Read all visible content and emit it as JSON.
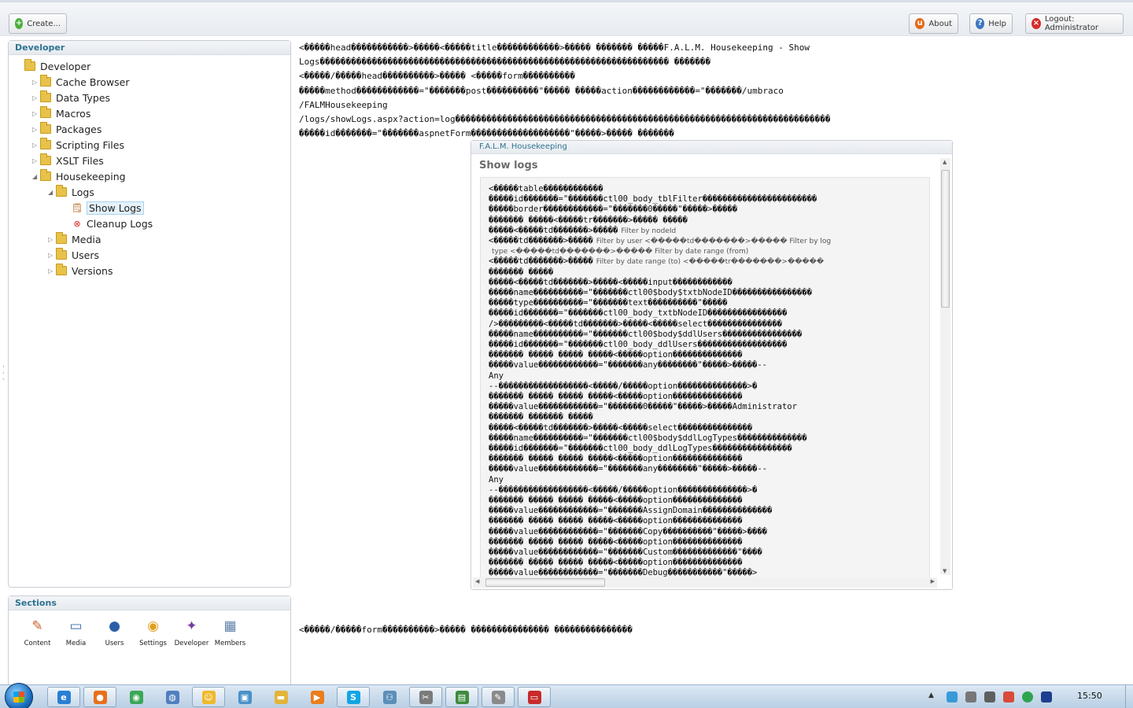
{
  "toolbar": {
    "create_label": "Create...",
    "about_label": "About",
    "help_label": "Help",
    "logout_label": "Logout: Administrator"
  },
  "developer_panel": {
    "header": "Developer",
    "tree": [
      {
        "label": "Developer",
        "level": 0,
        "icon": "folder-icon",
        "arrow": ""
      },
      {
        "label": "Cache Browser",
        "level": 1,
        "icon": "folder-icon",
        "arrow": "collapsed"
      },
      {
        "label": "Data Types",
        "level": 1,
        "icon": "folder-icon",
        "arrow": "collapsed"
      },
      {
        "label": "Macros",
        "level": 1,
        "icon": "folder-icon",
        "arrow": "collapsed"
      },
      {
        "label": "Packages",
        "level": 1,
        "icon": "folder-icon",
        "arrow": "collapsed"
      },
      {
        "label": "Scripting Files",
        "level": 1,
        "icon": "folder-icon",
        "arrow": "collapsed"
      },
      {
        "label": "XSLT Files",
        "level": 1,
        "icon": "folder-icon",
        "arrow": "collapsed"
      },
      {
        "label": "Housekeeping",
        "level": 1,
        "icon": "folder-icon",
        "arrow": "expanded"
      },
      {
        "label": "Logs",
        "level": 2,
        "icon": "folder-icon",
        "arrow": "expanded"
      },
      {
        "label": "Show Logs",
        "level": 3,
        "icon": "show-logs-icon",
        "arrow": "",
        "selected": true
      },
      {
        "label": "Cleanup Logs",
        "level": 3,
        "icon": "cleanup-logs-icon",
        "arrow": ""
      },
      {
        "label": "Media",
        "level": 2,
        "icon": "folder-icon",
        "arrow": "collapsed"
      },
      {
        "label": "Users",
        "level": 2,
        "icon": "folder-icon",
        "arrow": "collapsed"
      },
      {
        "label": "Versions",
        "level": 2,
        "icon": "folder-icon",
        "arrow": "collapsed"
      }
    ]
  },
  "sections_panel": {
    "header": "Sections",
    "items": [
      {
        "label": "Content",
        "icon": "content-icon"
      },
      {
        "label": "Media",
        "icon": "media-icon"
      },
      {
        "label": "Users",
        "icon": "users-icon"
      },
      {
        "label": "Settings",
        "icon": "settings-icon"
      },
      {
        "label": "Developer",
        "icon": "developer-icon"
      },
      {
        "label": "Members",
        "icon": "members-icon"
      }
    ]
  },
  "garbled_text": [
    "<�����head�����������>�����<�����title������������>����� ������� �����F.A.L.M. Housekeeping - Show",
    "Logs������������������������������������������������������������������� �������",
    "<�����/�����head����������>����� <�����form����������",
    "�����method������������=\"�������post����������\"����� �����action������������=\"�������/umbraco",
    "/FALMHousekeeping",
    "/logs/showLogs.aspx?action=log������������������������������������������������������������������������",
    "�����id�������=\"�������aspnetForm�������������������\"�����>����� �������"
  ],
  "garbled_footer": "<�����/�����form����������>����� ��������������� ���������������",
  "inner_window": {
    "header": "F.A.L.M. Housekeeping",
    "title": "Show logs",
    "code_lines": [
      {
        "text": "<�����table������������",
        "hint": ""
      },
      {
        "text": "�����id�������=\"�������ctl00_body_tblFilter�����������������������",
        "hint": ""
      },
      {
        "text": "�����border������������=\"�������0�����\"�����>�����",
        "hint": ""
      },
      {
        "text": "������� �����<�����tr�������>����� �����",
        "hint": ""
      },
      {
        "text": "�����<�����td�������>�����",
        "hint": "Filter by nodeId"
      },
      {
        "text": "<�����td�������>�����",
        "hint": "Filter by user  <�����td�������>�����  Filter by log"
      },
      {
        "text": "",
        "hint": "type  <�����td�������>�����  Filter by date range (from)"
      },
      {
        "text": "<�����td�������>�����",
        "hint": "Filter by date range (to)  <�����tr�������>�����"
      },
      {
        "text": "������� �����",
        "hint": ""
      },
      {
        "text": "�����<�����td�������>�����<�����input������������",
        "hint": ""
      },
      {
        "text": "�����name����������=\"�������ctl00$body$txtbNodeID����������������",
        "hint": ""
      },
      {
        "text": "�����type����������=\"�������text����������\"�����",
        "hint": ""
      },
      {
        "text": "�����id�������=\"�������ctl00_body_txtbNodeID����������������",
        "hint": ""
      },
      {
        "text": "/>���������<�����td�������>�����<�����select���������������",
        "hint": ""
      },
      {
        "text": "�����name����������=\"�������ctl00$body$ddlUsers����������������",
        "hint": ""
      },
      {
        "text": "�����id�������=\"�������ctl00_body_ddlUsers������������������",
        "hint": ""
      },
      {
        "text": "������� ����� ����� �����<�����option��������������",
        "hint": ""
      },
      {
        "text": "�����value������������=\"�������any��������\"�����>�����--",
        "hint": ""
      },
      {
        "text": "Any",
        "hint": ""
      },
      {
        "text": "--������������������<�����/�����option��������������>�",
        "hint": ""
      },
      {
        "text": "������� ����� ����� �����<�����option��������������",
        "hint": ""
      },
      {
        "text": "�����value������������=\"�������0�����\"�����>�����Administrator",
        "hint": ""
      },
      {
        "text": "������� ������� �����",
        "hint": ""
      },
      {
        "text": "�����<�����td�������>�����<�����select���������������",
        "hint": ""
      },
      {
        "text": "�����name����������=\"�������ctl00$body$ddlLogTypes��������������",
        "hint": ""
      },
      {
        "text": "�����id�������=\"�������ctl00_body_ddlLogTypes����������������",
        "hint": ""
      },
      {
        "text": "������� ����� ����� �����<�����option��������������",
        "hint": ""
      },
      {
        "text": "�����value������������=\"�������any��������\"�����>�����--",
        "hint": ""
      },
      {
        "text": "Any",
        "hint": ""
      },
      {
        "text": "--������������������<�����/�����option��������������>�",
        "hint": ""
      },
      {
        "text": "������� ����� ����� �����<�����option��������������",
        "hint": ""
      },
      {
        "text": "�����value������������=\"�������AssignDomain��������������",
        "hint": ""
      },
      {
        "text": "������� ����� ����� �����<�����option��������������",
        "hint": ""
      },
      {
        "text": "�����value������������=\"�������Copy����������\"�����>����",
        "hint": ""
      },
      {
        "text": "������� ����� ����� �����<�����option��������������",
        "hint": ""
      },
      {
        "text": "�����value������������=\"�������Custom�������������\"����",
        "hint": ""
      },
      {
        "text": "������� ����� ����� �����<�����option��������������",
        "hint": ""
      },
      {
        "text": "�����value������������=\"�������Debug�����������\"�����>",
        "hint": ""
      }
    ]
  },
  "taskbar": {
    "clock": "15:50",
    "apps": [
      {
        "name": "ie-icon",
        "color": "#2a7fd4",
        "open": true
      },
      {
        "name": "firefox-icon",
        "color": "#e8701a",
        "open": true
      },
      {
        "name": "chrome-icon",
        "color": "#3aa757",
        "open": false
      },
      {
        "name": "globe-icon",
        "color": "#4f7fbf",
        "open": false
      },
      {
        "name": "smiley-icon",
        "color": "#f0b82a",
        "open": true
      },
      {
        "name": "windows-explorer-icon",
        "color": "#4a90c8",
        "open": false
      },
      {
        "name": "folder-icon",
        "color": "#e4b43a",
        "open": false
      },
      {
        "name": "media-player-icon",
        "color": "#ea7d1c",
        "open": false
      },
      {
        "name": "skype-icon",
        "color": "#12a5e6",
        "open": true
      },
      {
        "name": "network-icon",
        "color": "#5b8fb8",
        "open": false
      },
      {
        "name": "tools-icon",
        "color": "#7b7b7b",
        "open": true
      },
      {
        "name": "remote-desktop-icon",
        "color": "#3d8b3d",
        "open": true
      },
      {
        "name": "notepad-icon",
        "color": "#8a8a8a",
        "open": true
      },
      {
        "name": "presentation-icon",
        "color": "#c92a2a",
        "open": true
      }
    ]
  }
}
